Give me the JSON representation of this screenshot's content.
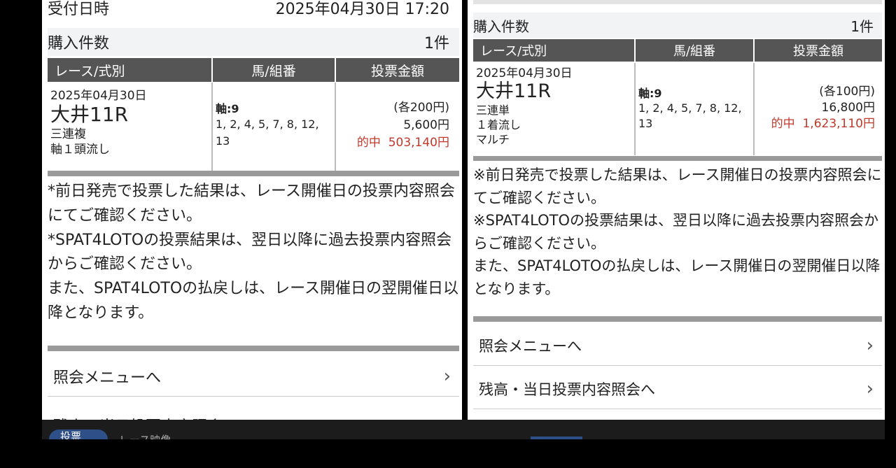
{
  "left": {
    "received_label": "受付日時",
    "received_value": "2025年04月30日 17:20",
    "count_label": "購入件数",
    "count_value": "1件",
    "headers": [
      "レース/式別",
      "馬/組番",
      "投票金額"
    ],
    "race": {
      "date": "2025年04月30日",
      "name": "大井11R",
      "type_lines": [
        "三連複",
        "軸１頭流し"
      ],
      "axis": "軸:9",
      "combos": "1, 2, 4, 5, 7, 8, 12, 13",
      "unit": "(各200円)",
      "total": "5,600円",
      "hit_label": "的中",
      "hit_amount": "503,140円"
    },
    "notes": [
      "*前日発売で投票した結果は、レース開催日の投票内容照会にてご確認ください。",
      "*SPAT4LOTOの投票結果は、翌日以降に過去投票内容照会からご確認ください。",
      "また、SPAT4LOTOの払戻しは、レース開催日の翌開催日以降となります。"
    ],
    "nav": [
      "照会メニューへ",
      "残高・当日投票内容照会へ"
    ]
  },
  "right": {
    "count_label": "購入件数",
    "count_value": "1件",
    "headers": [
      "レース/式別",
      "馬/組番",
      "投票金額"
    ],
    "race": {
      "date": "2025年04月30日",
      "name": "大井11R",
      "type_lines": [
        "三連単",
        "１着流し",
        "マルチ"
      ],
      "axis": "軸:9",
      "combos": "1, 2, 4, 5, 7, 8, 12, 13",
      "unit": "(各100円)",
      "total": "16,800円",
      "hit_label": "的中",
      "hit_amount": "1,623,110円"
    },
    "notes": [
      "※前日発売で投票した結果は、レース開催日の投票内容照会にてご確認ください。",
      "※SPAT4LOTOの投票結果は、翌日以降に過去投票内容照会からご確認ください。",
      "また、SPAT4LOTOの払戻しは、レース開催日の翌開催日以降となります。"
    ],
    "nav": [
      "照会メニューへ",
      "残高・当日投票内容照会へ"
    ]
  },
  "bottom": {
    "tab_label": "投票",
    "video_label": "レース映像"
  },
  "icons": {
    "chevron": "chevron-right-icon"
  },
  "colors": {
    "header": "#555555",
    "hit": "#c0392b",
    "background": "#000000"
  }
}
